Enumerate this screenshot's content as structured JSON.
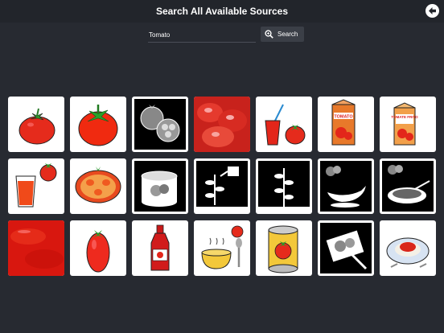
{
  "header": {
    "title": "Search All Available Sources",
    "back_icon": "back-arrow-icon"
  },
  "search": {
    "value": "Tomato",
    "placeholder": "",
    "button_label": "Search",
    "icon": "search-icon"
  },
  "results": [
    {
      "icon": "tomato-icon"
    },
    {
      "icon": "tomato-icon"
    },
    {
      "icon": "tomato-halves-icon"
    },
    {
      "icon": "tomato-photo-icon"
    },
    {
      "icon": "tomato-juice-glass-icon"
    },
    {
      "icon": "tomato-juice-carton-icon",
      "label": "TOMATO"
    },
    {
      "icon": "tomato-juice-carton-icon",
      "label": "TOMATE FRITO"
    },
    {
      "icon": "tomato-juice-glass-icon"
    },
    {
      "icon": "sliced-tomato-icon"
    },
    {
      "icon": "tomato-can-icon"
    },
    {
      "icon": "watering-plant-icon"
    },
    {
      "icon": "tomato-plant-icon"
    },
    {
      "icon": "tomato-sauce-boat-icon"
    },
    {
      "icon": "tomato-soup-icon"
    },
    {
      "icon": "tomato-puree-photo-icon"
    },
    {
      "icon": "plum-tomato-icon"
    },
    {
      "icon": "ketchup-bottle-icon"
    },
    {
      "icon": "tomato-soup-bowl-icon"
    },
    {
      "icon": "tomato-can-icon"
    },
    {
      "icon": "cutting-tomato-icon"
    },
    {
      "icon": "pasta-tomato-sauce-icon"
    }
  ]
}
